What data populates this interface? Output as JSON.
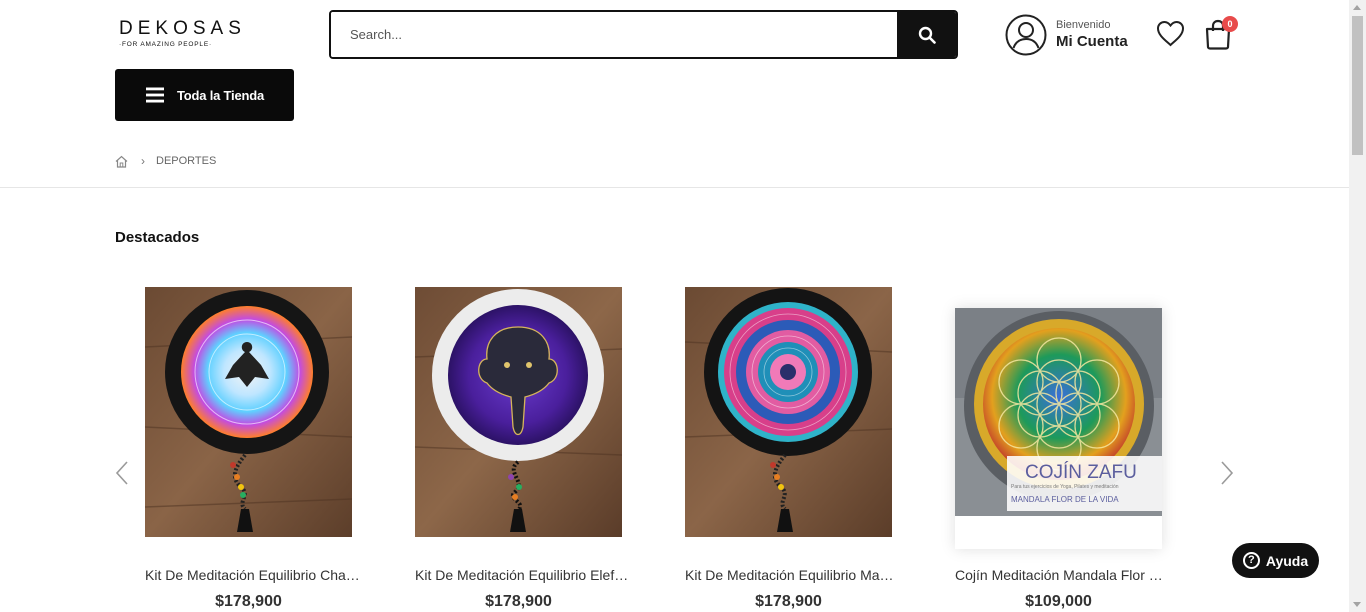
{
  "header": {
    "logo": {
      "name": "DEKOSAS",
      "tagline": "·FOR AMAZING PEOPLE·"
    },
    "search": {
      "placeholder": "Search...",
      "value": ""
    },
    "account": {
      "welcome": "Bienvenido",
      "name": "Mi Cuenta"
    },
    "cart": {
      "count": "0"
    },
    "store_button": "Toda la Tienda"
  },
  "breadcrumb": {
    "current": "DEPORTES"
  },
  "section": {
    "title": "Destacados"
  },
  "products": [
    {
      "name": "Kit De Meditación Equilibrio Chakras",
      "price": "$178,900",
      "image": "chakra-meditation-cushion"
    },
    {
      "name": "Kit De Meditación Equilibrio Elefante",
      "price": "$178,900",
      "image": "elephant-meditation-cushion"
    },
    {
      "name": "Kit De Meditación Equilibrio Mandala",
      "price": "$178,900",
      "image": "mandala-meditation-cushion"
    },
    {
      "name": "Cojín Meditación Mandala Flor de la Vida",
      "price": "$109,000",
      "image": "flower-of-life-zafu-cushion",
      "overlay": {
        "title": "COJÍN ZAFU",
        "subtitle": "Para tus ejercicios de Yoga, Pilates y meditación",
        "caption": "MANDALA FLOR DE LA VIDA"
      }
    }
  ],
  "help": {
    "label": "Ayuda"
  },
  "colors": {
    "primary": "#111111",
    "badge": "#e84b4b",
    "divider": "#e6e6e6"
  }
}
